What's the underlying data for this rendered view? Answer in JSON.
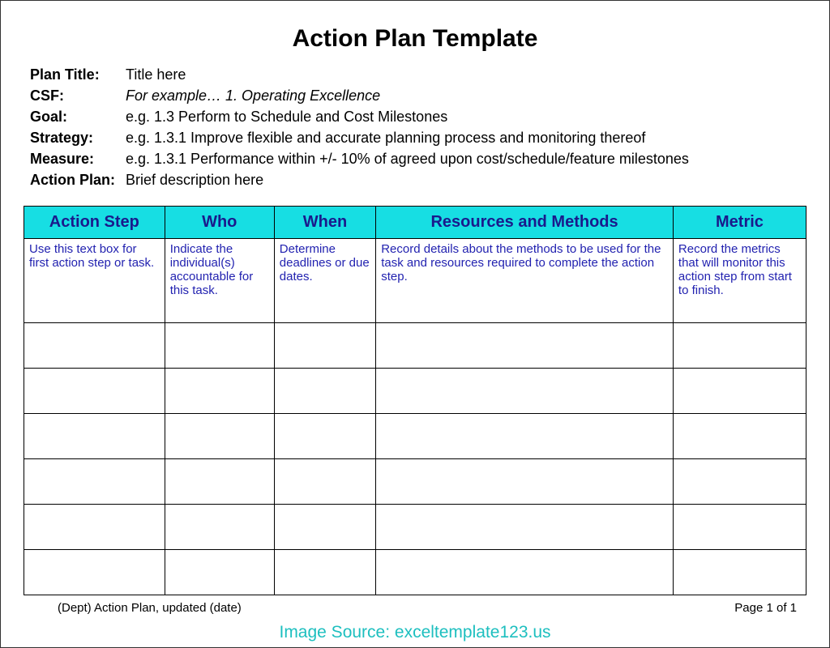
{
  "title": "Action Plan Template",
  "meta": {
    "planTitle": {
      "label": "Plan Title:",
      "value": "Title here"
    },
    "csf": {
      "label": "CSF:",
      "value": "For example… 1. Operating Excellence"
    },
    "goal": {
      "label": "Goal:",
      "value": "e.g. 1.3  Perform to Schedule and Cost Milestones"
    },
    "strategy": {
      "label": "Strategy:",
      "value": "e.g. 1.3.1  Improve flexible and accurate planning process and monitoring thereof"
    },
    "measure": {
      "label": "Measure:",
      "value": "e.g. 1.3.1  Performance within +/- 10% of agreed upon cost/schedule/feature milestones"
    },
    "actionPlan": {
      "label": "Action Plan:",
      "value": "Brief description here"
    }
  },
  "table": {
    "headers": {
      "actionStep": "Action Step",
      "who": "Who",
      "when": "When",
      "resources": "Resources and Methods",
      "metric": "Metric"
    },
    "hints": {
      "actionStep": "Use this text box for first action step or task.",
      "who": "Indicate the individual(s) accountable for this task.",
      "when": "Determine deadlines or due dates.",
      "resources": "Record details about the methods to be used for the task and resources required to complete the action step.",
      "metric": "Record the metrics that will monitor this action step from start to finish."
    }
  },
  "footer": {
    "left": "(Dept) Action Plan, updated (date)",
    "right": "Page 1 of 1"
  },
  "source": "Image Source: exceltemplate123.us"
}
